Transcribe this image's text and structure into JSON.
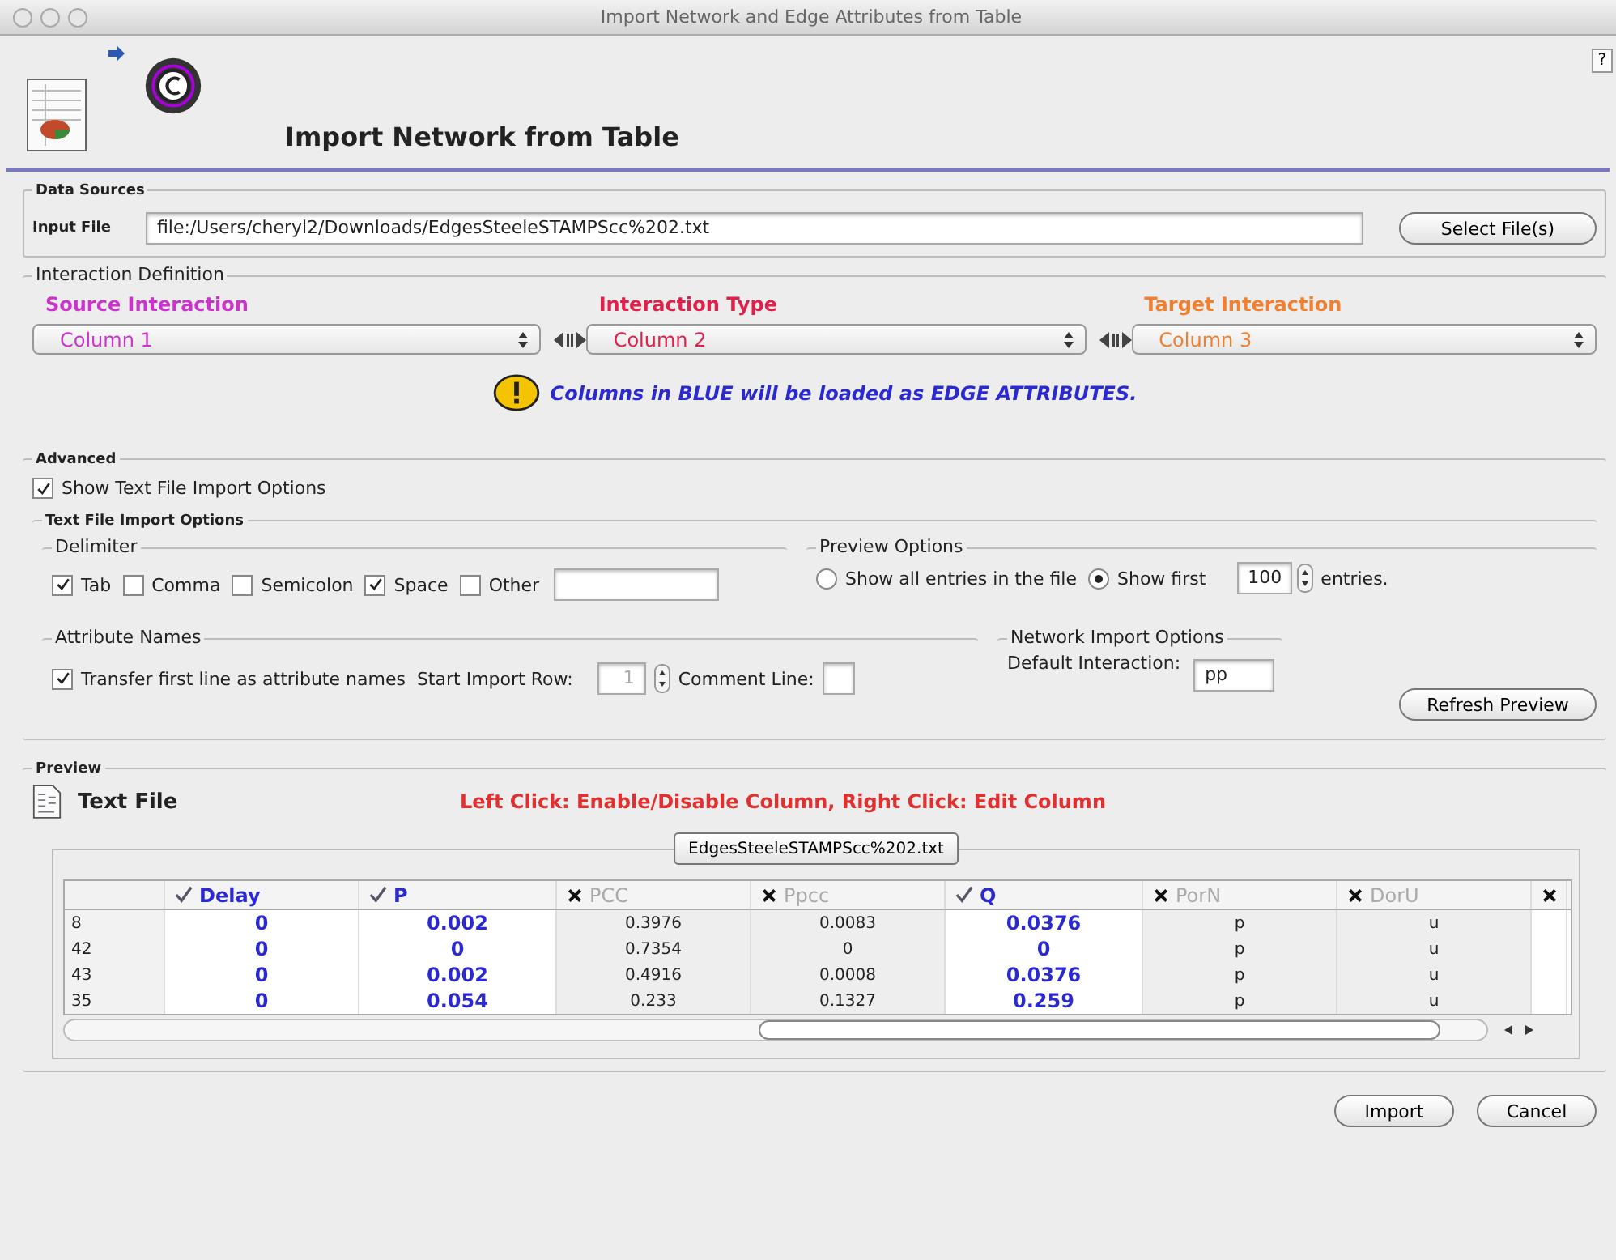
{
  "window": {
    "title": "Import Network and Edge Attributes from Table"
  },
  "header": {
    "title": "Import Network from Table",
    "help": "?"
  },
  "data_sources": {
    "legend": "Data Sources",
    "label": "Input File",
    "value": "file:/Users/cheryl2/Downloads/EdgesSteeleSTAMPScc%202.txt",
    "button": "Select File(s)"
  },
  "interaction": {
    "legend": "Interaction Definition",
    "columns": [
      {
        "label": "Source Interaction",
        "value": "Column 1",
        "color": "#cc33cc"
      },
      {
        "label": "Interaction Type",
        "value": "Column 2",
        "color": "#e0204a"
      },
      {
        "label": "Target Interaction",
        "value": "Column 3",
        "color": "#f07f30"
      }
    ],
    "note": "Columns in BLUE will be loaded as EDGE ATTRIBUTES."
  },
  "advanced": {
    "legend": "Advanced",
    "show_options": {
      "label": "Show Text File Import Options",
      "checked": true
    },
    "options_legend": "Text File Import Options",
    "delimiter": {
      "legend": "Delimiter",
      "options": [
        {
          "label": "Tab",
          "checked": true
        },
        {
          "label": "Comma",
          "checked": false
        },
        {
          "label": "Semicolon",
          "checked": false
        },
        {
          "label": "Space",
          "checked": true
        },
        {
          "label": "Other",
          "checked": false
        }
      ]
    },
    "preview_options": {
      "legend": "Preview Options",
      "radios": [
        {
          "label": "Show all entries in the file",
          "selected": false
        },
        {
          "label": "Show first",
          "selected": true
        }
      ],
      "count": "100",
      "suffix": "entries."
    },
    "attribute_names": {
      "legend": "Attribute Names",
      "transfer": {
        "label": "Transfer first line as attribute names",
        "checked": true
      },
      "start_row_label": "Start Import Row:",
      "start_row": "1",
      "comment_label": "Comment Line:"
    },
    "network_import": {
      "legend": "Network Import Options",
      "default_label": "Default Interaction:",
      "default_value": "pp"
    },
    "refresh_button": "Refresh Preview"
  },
  "preview": {
    "legend": "Preview",
    "title": "Text File",
    "hint": "Left Click: Enable/Disable Column, Right Click: Edit Column",
    "tab": "EdgesSteeleSTAMPScc%202.txt",
    "columns": [
      {
        "name": "Delay",
        "enabled": true
      },
      {
        "name": "P",
        "enabled": true
      },
      {
        "name": "PCC",
        "enabled": false
      },
      {
        "name": "Ppcc",
        "enabled": false
      },
      {
        "name": "Q",
        "enabled": true
      },
      {
        "name": "PorN",
        "enabled": false
      },
      {
        "name": "DorU",
        "enabled": false
      },
      {
        "enabled": false
      }
    ],
    "rows": [
      {
        "key": "8",
        "cells": [
          "0",
          "0.002",
          "0.3976",
          "0.0083",
          "0.0376",
          "p",
          "u"
        ]
      },
      {
        "key": "42",
        "cells": [
          "0",
          "0",
          "0.7354",
          "0",
          "0",
          "p",
          "u"
        ]
      },
      {
        "key": "43",
        "cells": [
          "0",
          "0.002",
          "0.4916",
          "0.0008",
          "0.0376",
          "p",
          "u"
        ]
      },
      {
        "key": "35",
        "cells": [
          "0",
          "0.054",
          "0.233",
          "0.1327",
          "0.259",
          "p",
          "u"
        ]
      }
    ]
  },
  "buttons": [
    "Import",
    "Cancel"
  ]
}
